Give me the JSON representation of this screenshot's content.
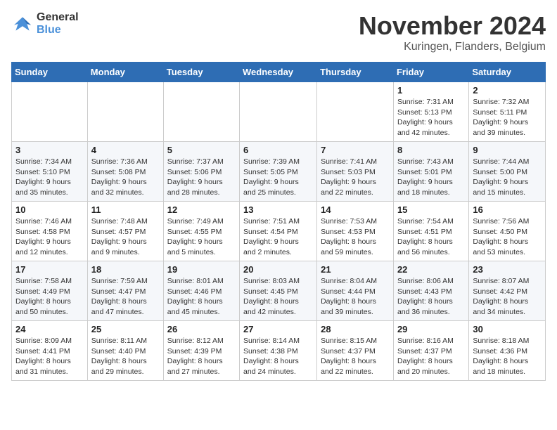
{
  "logo": {
    "line1": "General",
    "line2": "Blue"
  },
  "title": "November 2024",
  "location": "Kuringen, Flanders, Belgium",
  "days_of_week": [
    "Sunday",
    "Monday",
    "Tuesday",
    "Wednesday",
    "Thursday",
    "Friday",
    "Saturday"
  ],
  "weeks": [
    [
      {
        "day": "",
        "info": ""
      },
      {
        "day": "",
        "info": ""
      },
      {
        "day": "",
        "info": ""
      },
      {
        "day": "",
        "info": ""
      },
      {
        "day": "",
        "info": ""
      },
      {
        "day": "1",
        "info": "Sunrise: 7:31 AM\nSunset: 5:13 PM\nDaylight: 9 hours\nand 42 minutes."
      },
      {
        "day": "2",
        "info": "Sunrise: 7:32 AM\nSunset: 5:11 PM\nDaylight: 9 hours\nand 39 minutes."
      }
    ],
    [
      {
        "day": "3",
        "info": "Sunrise: 7:34 AM\nSunset: 5:10 PM\nDaylight: 9 hours\nand 35 minutes."
      },
      {
        "day": "4",
        "info": "Sunrise: 7:36 AM\nSunset: 5:08 PM\nDaylight: 9 hours\nand 32 minutes."
      },
      {
        "day": "5",
        "info": "Sunrise: 7:37 AM\nSunset: 5:06 PM\nDaylight: 9 hours\nand 28 minutes."
      },
      {
        "day": "6",
        "info": "Sunrise: 7:39 AM\nSunset: 5:05 PM\nDaylight: 9 hours\nand 25 minutes."
      },
      {
        "day": "7",
        "info": "Sunrise: 7:41 AM\nSunset: 5:03 PM\nDaylight: 9 hours\nand 22 minutes."
      },
      {
        "day": "8",
        "info": "Sunrise: 7:43 AM\nSunset: 5:01 PM\nDaylight: 9 hours\nand 18 minutes."
      },
      {
        "day": "9",
        "info": "Sunrise: 7:44 AM\nSunset: 5:00 PM\nDaylight: 9 hours\nand 15 minutes."
      }
    ],
    [
      {
        "day": "10",
        "info": "Sunrise: 7:46 AM\nSunset: 4:58 PM\nDaylight: 9 hours\nand 12 minutes."
      },
      {
        "day": "11",
        "info": "Sunrise: 7:48 AM\nSunset: 4:57 PM\nDaylight: 9 hours\nand 9 minutes."
      },
      {
        "day": "12",
        "info": "Sunrise: 7:49 AM\nSunset: 4:55 PM\nDaylight: 9 hours\nand 5 minutes."
      },
      {
        "day": "13",
        "info": "Sunrise: 7:51 AM\nSunset: 4:54 PM\nDaylight: 9 hours\nand 2 minutes."
      },
      {
        "day": "14",
        "info": "Sunrise: 7:53 AM\nSunset: 4:53 PM\nDaylight: 8 hours\nand 59 minutes."
      },
      {
        "day": "15",
        "info": "Sunrise: 7:54 AM\nSunset: 4:51 PM\nDaylight: 8 hours\nand 56 minutes."
      },
      {
        "day": "16",
        "info": "Sunrise: 7:56 AM\nSunset: 4:50 PM\nDaylight: 8 hours\nand 53 minutes."
      }
    ],
    [
      {
        "day": "17",
        "info": "Sunrise: 7:58 AM\nSunset: 4:49 PM\nDaylight: 8 hours\nand 50 minutes."
      },
      {
        "day": "18",
        "info": "Sunrise: 7:59 AM\nSunset: 4:47 PM\nDaylight: 8 hours\nand 47 minutes."
      },
      {
        "day": "19",
        "info": "Sunrise: 8:01 AM\nSunset: 4:46 PM\nDaylight: 8 hours\nand 45 minutes."
      },
      {
        "day": "20",
        "info": "Sunrise: 8:03 AM\nSunset: 4:45 PM\nDaylight: 8 hours\nand 42 minutes."
      },
      {
        "day": "21",
        "info": "Sunrise: 8:04 AM\nSunset: 4:44 PM\nDaylight: 8 hours\nand 39 minutes."
      },
      {
        "day": "22",
        "info": "Sunrise: 8:06 AM\nSunset: 4:43 PM\nDaylight: 8 hours\nand 36 minutes."
      },
      {
        "day": "23",
        "info": "Sunrise: 8:07 AM\nSunset: 4:42 PM\nDaylight: 8 hours\nand 34 minutes."
      }
    ],
    [
      {
        "day": "24",
        "info": "Sunrise: 8:09 AM\nSunset: 4:41 PM\nDaylight: 8 hours\nand 31 minutes."
      },
      {
        "day": "25",
        "info": "Sunrise: 8:11 AM\nSunset: 4:40 PM\nDaylight: 8 hours\nand 29 minutes."
      },
      {
        "day": "26",
        "info": "Sunrise: 8:12 AM\nSunset: 4:39 PM\nDaylight: 8 hours\nand 27 minutes."
      },
      {
        "day": "27",
        "info": "Sunrise: 8:14 AM\nSunset: 4:38 PM\nDaylight: 8 hours\nand 24 minutes."
      },
      {
        "day": "28",
        "info": "Sunrise: 8:15 AM\nSunset: 4:37 PM\nDaylight: 8 hours\nand 22 minutes."
      },
      {
        "day": "29",
        "info": "Sunrise: 8:16 AM\nSunset: 4:37 PM\nDaylight: 8 hours\nand 20 minutes."
      },
      {
        "day": "30",
        "info": "Sunrise: 8:18 AM\nSunset: 4:36 PM\nDaylight: 8 hours\nand 18 minutes."
      }
    ]
  ]
}
